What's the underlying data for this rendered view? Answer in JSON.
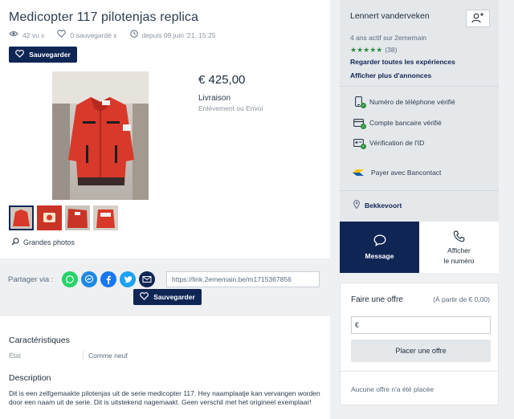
{
  "listing": {
    "title": "Medicopter 117 pilotenjas replica",
    "views": "42 vu x",
    "saved": "0 sauvegardé x",
    "since": "depuis 09 juin '21, 15:25",
    "save_label": "Sauvegarder",
    "price": "€ 425,00",
    "delivery_title": "Livraison",
    "delivery_mode": "Enlèvement ou Envoi",
    "large_photos": "Grandes photos"
  },
  "share": {
    "label": "Partager via :",
    "link": "https://link.2ememain.be/m1715367856",
    "save_label": "Sauvegarder"
  },
  "characteristics": {
    "title": "Caractéristiques",
    "state_label": "État",
    "state_value": "Comme neuf"
  },
  "description": {
    "title": "Description",
    "text": "Dit is een zelfgemaakte pilotenjas uit de serie medicopter 117. Hey naamplaatje kan vervangen worden door een naam uit de serie. Dit is uitstekend nagemaakt. Geen verschil met het origineel exemplaar!"
  },
  "seller": {
    "name": "Lennert vanderveken",
    "active": "4 ans actif sur 2ememain",
    "stars": "★★★★★",
    "rating_count": "(38)",
    "rating": 5,
    "link_reviews": "Regarder toutes les expériences",
    "link_more": "Afficher plus d'annonces",
    "verified_phone": "Numéro de téléphone vérifié",
    "verified_bank": "Compte bancaire vérifié",
    "verified_id": "Vérification de l'ID",
    "bancontact": "Payer avec Bancontact",
    "location": "Bekkevoort",
    "message_label": "Message",
    "number_label_1": "Afficher",
    "number_label_2": "le numéro"
  },
  "offer": {
    "title": "Faire une offre",
    "min": "(À partir de € 0,00)",
    "currency": "€",
    "button": "Placer une offre",
    "none": "Aucune offre n'a été placée"
  },
  "colors": {
    "navy": "#0f2655",
    "green": "#2d8f3e",
    "whatsapp": "#25d366",
    "messenger": "#1e88e5",
    "facebook": "#1877f2",
    "twitter": "#1da1f2",
    "email": "#0f2655"
  }
}
